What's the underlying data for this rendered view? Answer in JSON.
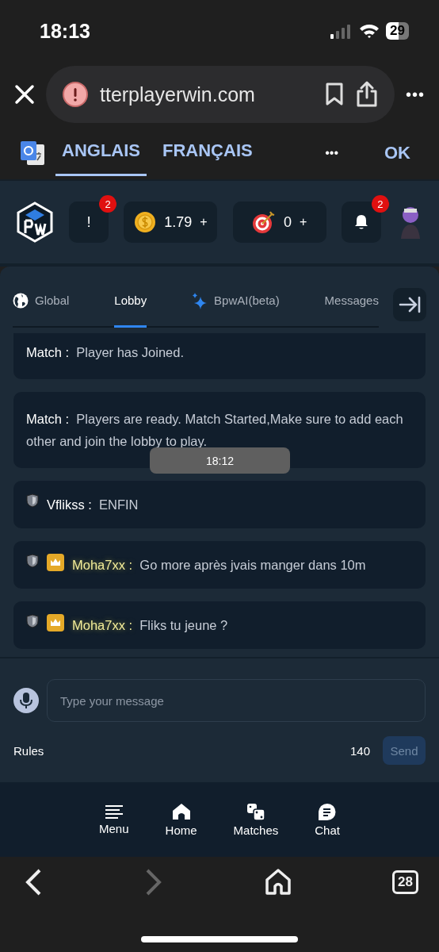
{
  "status_bar": {
    "time": "18:13",
    "battery": "29"
  },
  "browser": {
    "url": "tterplayerwin.com",
    "more": "•••"
  },
  "translate_bar": {
    "languages": [
      {
        "label": "ANGLAIS",
        "selected": true
      },
      {
        "label": "FRANÇAIS",
        "selected": false
      }
    ],
    "more": "•••",
    "ok": "OK"
  },
  "header": {
    "alert": {
      "label": "!",
      "badge": "2"
    },
    "coins": {
      "value": "1.79",
      "plus": "+"
    },
    "targets": {
      "value": "0",
      "plus": "+"
    },
    "notifications": {
      "badge": "2"
    }
  },
  "tabs": [
    {
      "label": "Global",
      "selected": false
    },
    {
      "label": "Lobby",
      "selected": true
    },
    {
      "label": "BpwAI(beta)",
      "selected": false
    },
    {
      "label": "Messages",
      "selected": false
    }
  ],
  "messages": [
    {
      "kind": "system",
      "sender": "Match :",
      "text": "Player has Joined."
    },
    {
      "kind": "system",
      "sender": "Match :",
      "text": "Players are ready. Match Started,Make sure to add each other and join the lobby to play."
    },
    {
      "kind": "user",
      "sender": "Vflikss :",
      "text": "ENFIN",
      "vip": false
    },
    {
      "kind": "user",
      "sender": "Moha7xx :",
      "text": "Go more après jvais manger dans 10m",
      "vip": true
    },
    {
      "kind": "user",
      "sender": "Moha7xx :",
      "text": "Fliks tu jeune ?",
      "vip": true
    }
  ],
  "tooltip": "18:12",
  "composer": {
    "placeholder": "Type your message",
    "rules": "Rules",
    "count": "140",
    "send": "Send",
    "send_disabled": true
  },
  "nav": [
    {
      "label": "Menu"
    },
    {
      "label": "Home"
    },
    {
      "label": "Matches"
    },
    {
      "label": "Chat"
    }
  ],
  "browser_toolbar": {
    "forward_disabled": true,
    "tab_count": "28"
  }
}
